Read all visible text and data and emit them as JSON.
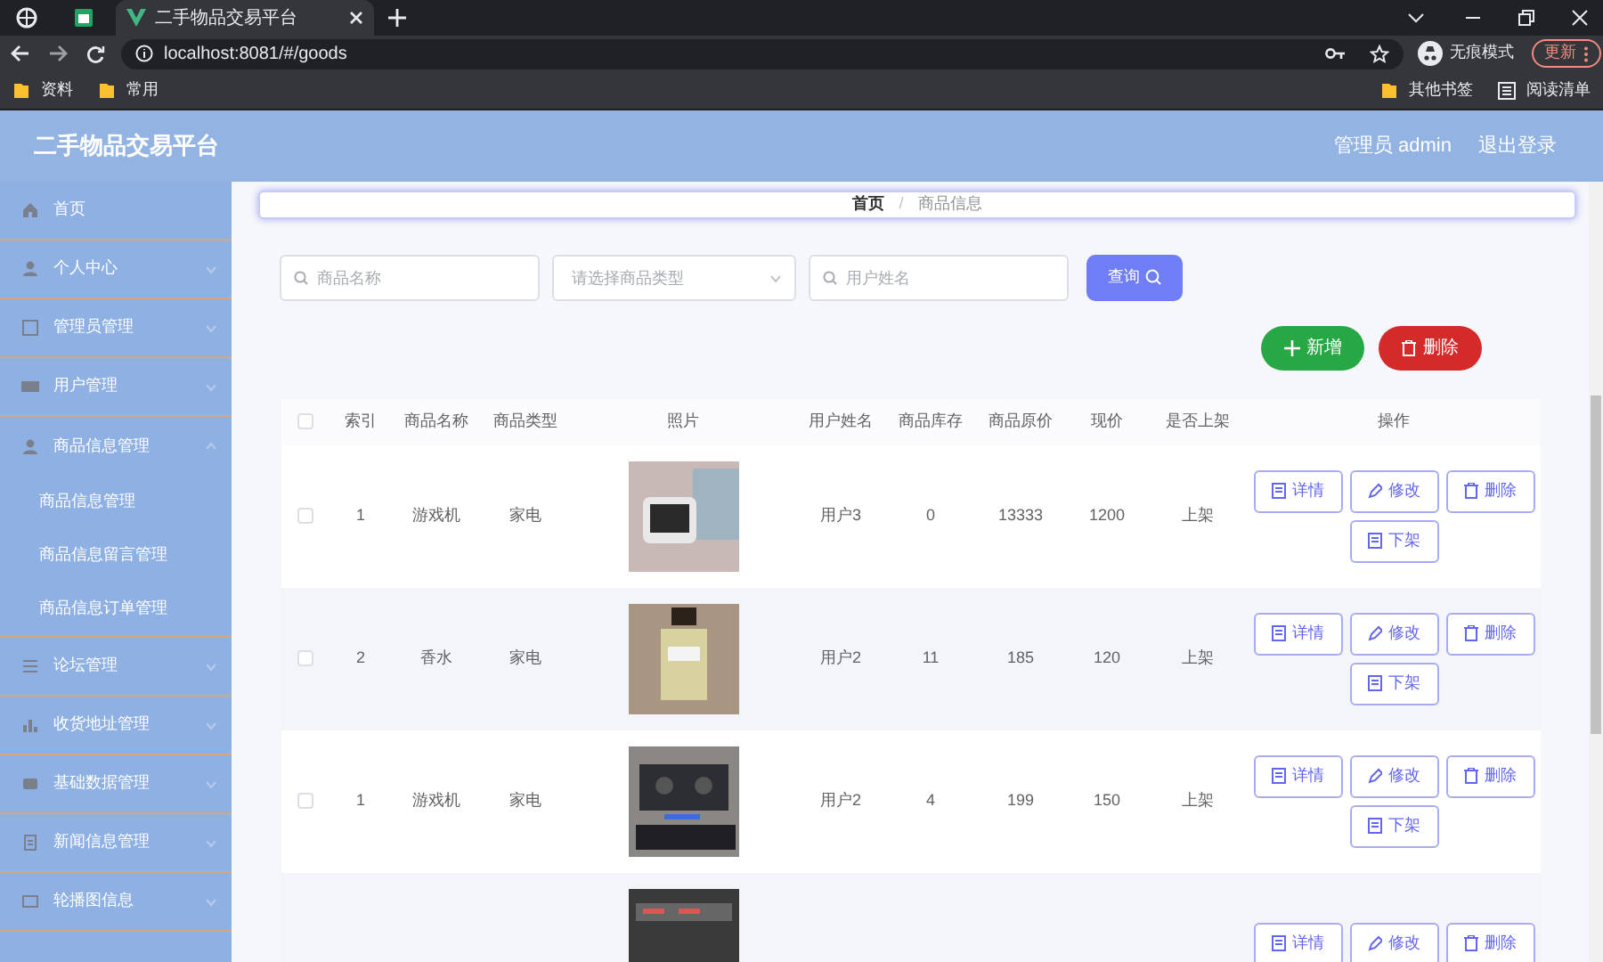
{
  "browser": {
    "tabs": [
      {
        "title": "二手物品交易平台",
        "selected": true
      }
    ],
    "url": "localhost:8081/#/goods",
    "incognito_label": "无痕模式",
    "update_label": "更新",
    "bookmarks": [
      "资料",
      "常用"
    ],
    "other_bookmarks": "其他书签",
    "reading_list": "阅读清单"
  },
  "app": {
    "title": "二手物品交易平台",
    "user": "管理员 admin",
    "logout": "退出登录"
  },
  "sidebar": {
    "items": [
      {
        "label": "首页"
      },
      {
        "label": "个人中心",
        "expanded": false
      },
      {
        "label": "管理员管理",
        "expanded": false
      },
      {
        "label": "用户管理",
        "expanded": false
      },
      {
        "label": "商品信息管理",
        "expanded": true,
        "children": [
          {
            "label": "商品信息管理"
          },
          {
            "label": "商品信息留言管理"
          },
          {
            "label": "商品信息订单管理"
          }
        ]
      },
      {
        "label": "论坛管理",
        "expanded": false
      },
      {
        "label": "收货地址管理",
        "expanded": false
      },
      {
        "label": "基础数据管理",
        "expanded": false
      },
      {
        "label": "新闻信息管理",
        "expanded": false
      },
      {
        "label": "轮播图信息",
        "expanded": false
      }
    ]
  },
  "breadcrumb": {
    "items": [
      "首页",
      "商品信息"
    ],
    "separator": "/"
  },
  "search": {
    "fields": [
      {
        "kind": "search",
        "placeholder": "商品名称"
      },
      {
        "kind": "select",
        "placeholder": "请选择商品类型"
      },
      {
        "kind": "search",
        "placeholder": "用户姓名"
      }
    ],
    "query_button": "查询"
  },
  "toolbar": {
    "add_button": "新增",
    "delete_button": "删除"
  },
  "table": {
    "select_all": {
      "checked": false
    },
    "columns": [
      "索引",
      "商品名称",
      "商品类型",
      "照片",
      "用户姓名",
      "商品库存",
      "商品原价",
      "现价",
      "是否上架",
      "操作"
    ],
    "rows": [
      {
        "checked": false,
        "cells": [
          "1",
          "游戏机",
          "家电",
          null,
          "用户3",
          "0",
          "13333",
          "1200",
          "上架"
        ],
        "photo": true,
        "actions": [
          {
            "kind": "detail",
            "label": "详情"
          },
          {
            "kind": "edit",
            "label": "修改"
          },
          {
            "kind": "delete",
            "label": "删除"
          },
          {
            "kind": "off",
            "label": "下架"
          }
        ]
      },
      {
        "checked": false,
        "cells": [
          "2",
          "香水",
          "家电",
          null,
          "用户2",
          "11",
          "185",
          "120",
          "上架"
        ],
        "photo": true,
        "actions": [
          {
            "kind": "detail",
            "label": "详情"
          },
          {
            "kind": "edit",
            "label": "修改"
          },
          {
            "kind": "delete",
            "label": "删除"
          },
          {
            "kind": "off",
            "label": "下架"
          }
        ]
      },
      {
        "checked": false,
        "cells": [
          "1",
          "游戏机",
          "家电",
          null,
          "用户2",
          "4",
          "199",
          "150",
          "上架"
        ],
        "photo": true,
        "actions": [
          {
            "kind": "detail",
            "label": "详情"
          },
          {
            "kind": "edit",
            "label": "修改"
          },
          {
            "kind": "delete",
            "label": "删除"
          },
          {
            "kind": "off",
            "label": "下架"
          }
        ]
      },
      {
        "photo": true,
        "actions": [
          {
            "kind": "detail",
            "label": "详情"
          },
          {
            "kind": "edit",
            "label": "修改"
          },
          {
            "kind": "delete",
            "label": "删除"
          }
        ]
      }
    ]
  }
}
